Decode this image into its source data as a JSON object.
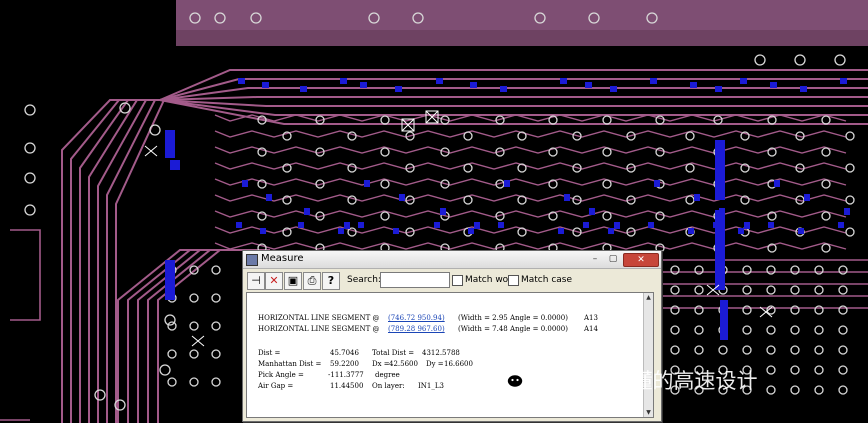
{
  "window": {
    "title": "Measure",
    "controls": {
      "minimize": "–",
      "maximize": "▢",
      "close": "✕"
    }
  },
  "toolbar": {
    "pin": "⊣",
    "delete": "✕",
    "save": "▣",
    "print": "⎙",
    "help": "?",
    "search_label": "Search:",
    "search_value": "",
    "match_word": "Match word",
    "match_case": "Match case"
  },
  "measurements": [
    {
      "kind": "HORIZONTAL LINE SEGMENT @",
      "coords": "(746.72 950.94)",
      "detail": "(Width = 2.95 Angle = 0.0000)",
      "ref": "A13"
    },
    {
      "kind": "HORIZONTAL LINE SEGMENT @",
      "coords": "(789.28 967.60)",
      "detail": "(Width = 7.48 Angle = 0.0000)",
      "ref": "A14"
    }
  ],
  "results": {
    "dist_label": "Dist =",
    "dist": "45.7046",
    "total_label": "Total Dist =",
    "total": "4312.5788",
    "manhattan_label": "Manhattan Dist =",
    "manhattan": "59.2200",
    "dx_label": "Dx =",
    "dx": "42.5600",
    "dy_label": "Dy =",
    "dy": "16.6600",
    "pick_label": "Pick Angle =",
    "pick": "-111.3777",
    "pick_unit": "degree",
    "airgap_label": "Air Gap =",
    "airgap": "11.44500",
    "layer_label": "On layer:",
    "layer": "IN1_L3"
  },
  "watermark": "一博_看得懂的高速设计",
  "colors": {
    "board": "#000000",
    "trace": "#a35b8a",
    "pad_blue": "#1b1bd6",
    "copper_fill": "#7e4e73",
    "dialog_bg": "#ece9d8"
  }
}
